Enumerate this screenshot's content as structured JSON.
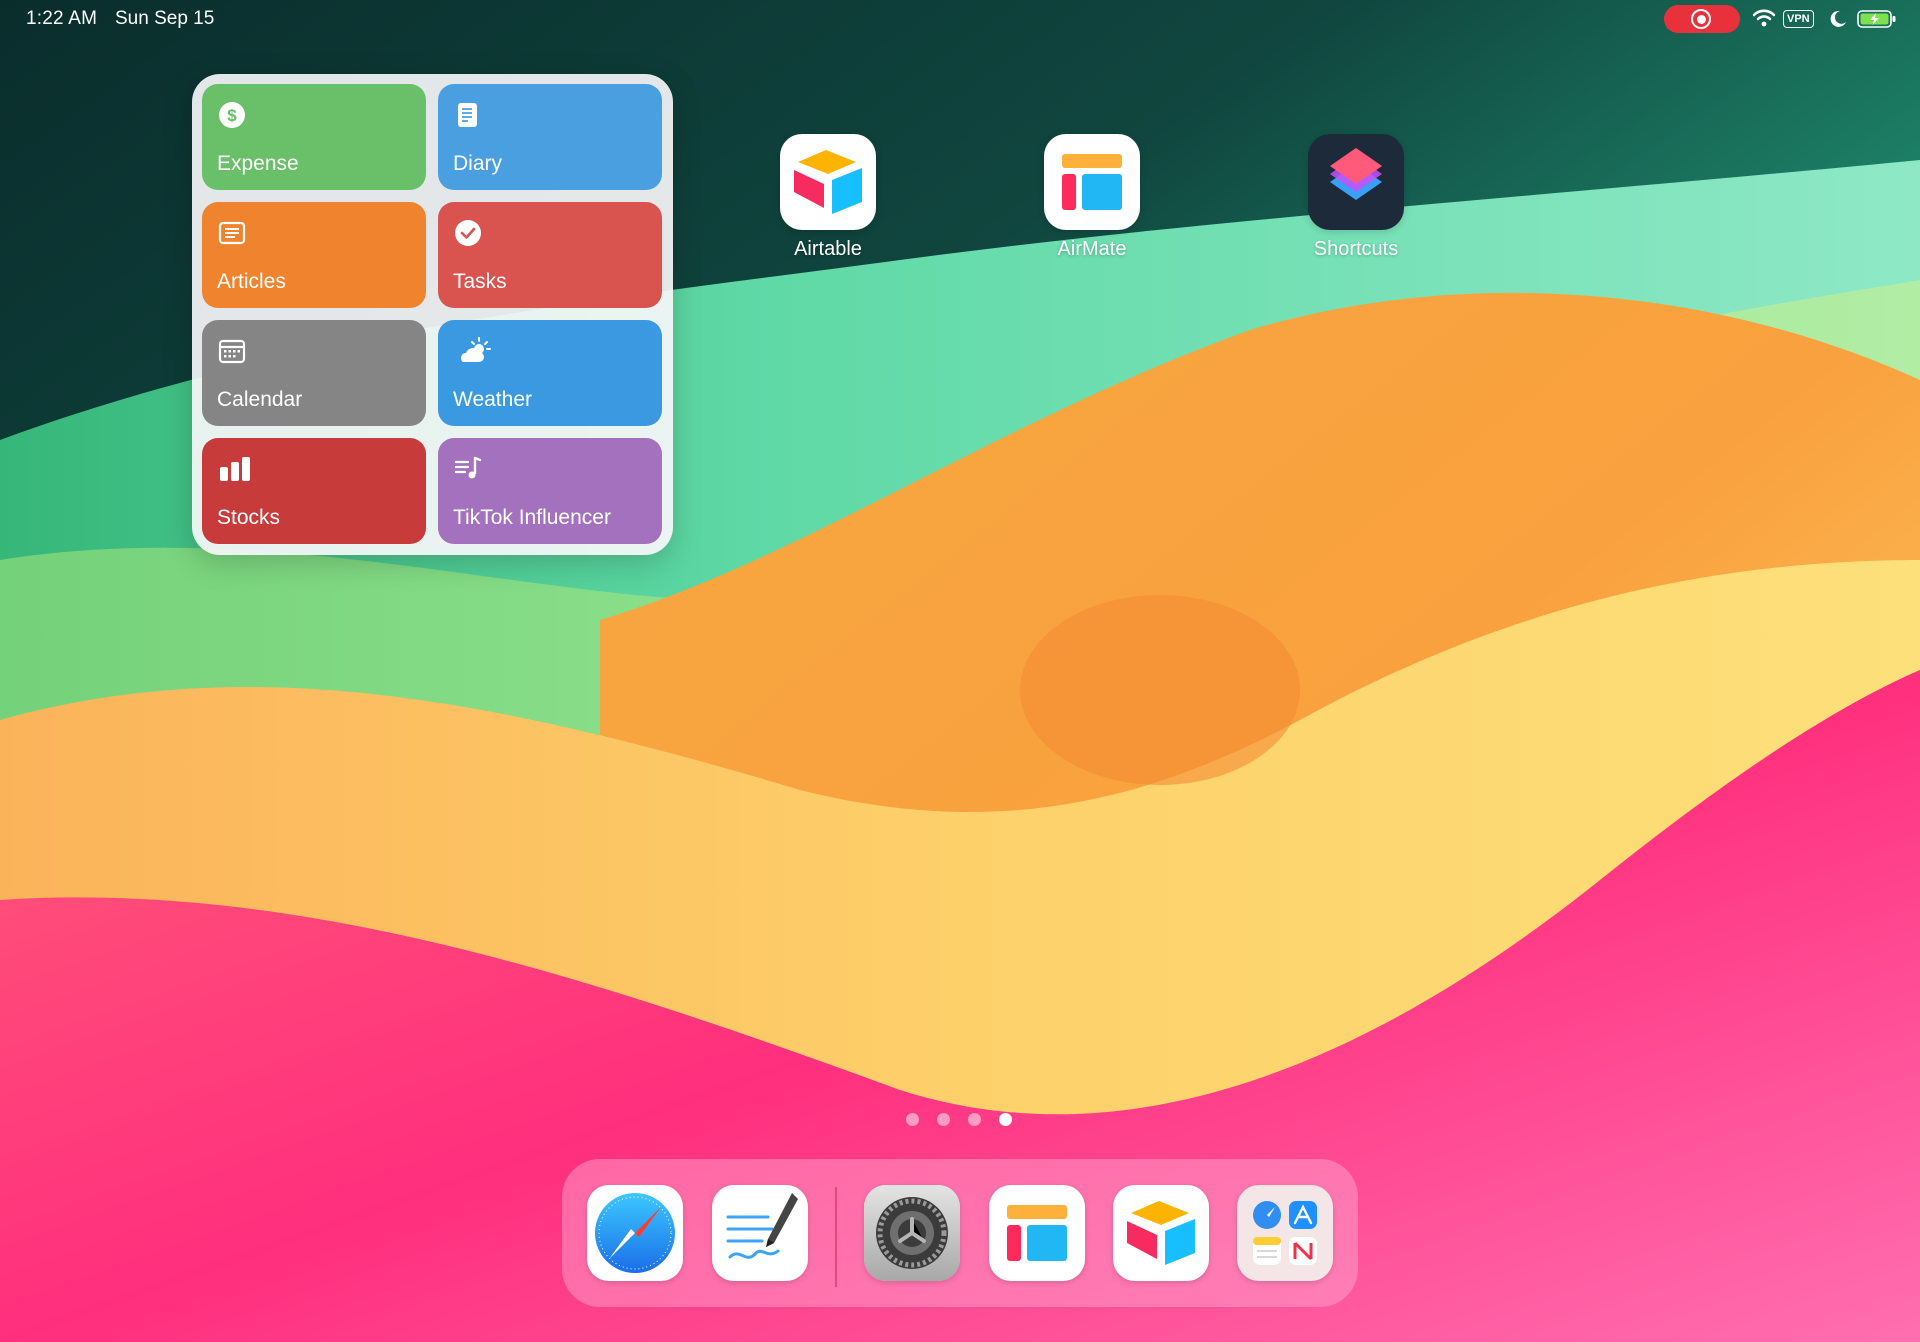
{
  "status_bar": {
    "time": "1:22 AM",
    "date": "Sun Sep 15",
    "vpn_label": "VPN",
    "icons": [
      "screen-record-icon",
      "wifi-icon",
      "vpn-icon",
      "moon-icon",
      "battery-charging-icon"
    ]
  },
  "widget": {
    "tiles": [
      {
        "label": "Expense",
        "icon": "dollar-icon",
        "color": "#6abf69"
      },
      {
        "label": "Diary",
        "icon": "document-icon",
        "color": "#4a9fe0"
      },
      {
        "label": "Articles",
        "icon": "list-icon",
        "color": "#ef832e"
      },
      {
        "label": "Tasks",
        "icon": "checkmark-icon",
        "color": "#d9534f"
      },
      {
        "label": "Calendar",
        "icon": "calendar-icon",
        "color": "#858585"
      },
      {
        "label": "Weather",
        "icon": "weather-icon",
        "color": "#3a99e0"
      },
      {
        "label": "Stocks",
        "icon": "bar-chart-icon",
        "color": "#c73b3b"
      },
      {
        "label": "TikTok Influencer",
        "icon": "music-list-icon",
        "color": "#a471be"
      }
    ]
  },
  "apps": [
    {
      "label": "Airtable",
      "icon": "airtable-icon"
    },
    {
      "label": "AirMate",
      "icon": "airmate-icon"
    },
    {
      "label": "Shortcuts",
      "icon": "shortcuts-icon"
    }
  ],
  "page_indicator": {
    "total": 4,
    "active": 4
  },
  "dock": {
    "apps": [
      "safari-icon",
      "freeform-icon",
      "settings-icon",
      "airmate-icon",
      "airtable-icon",
      "app-library-icon"
    ]
  }
}
